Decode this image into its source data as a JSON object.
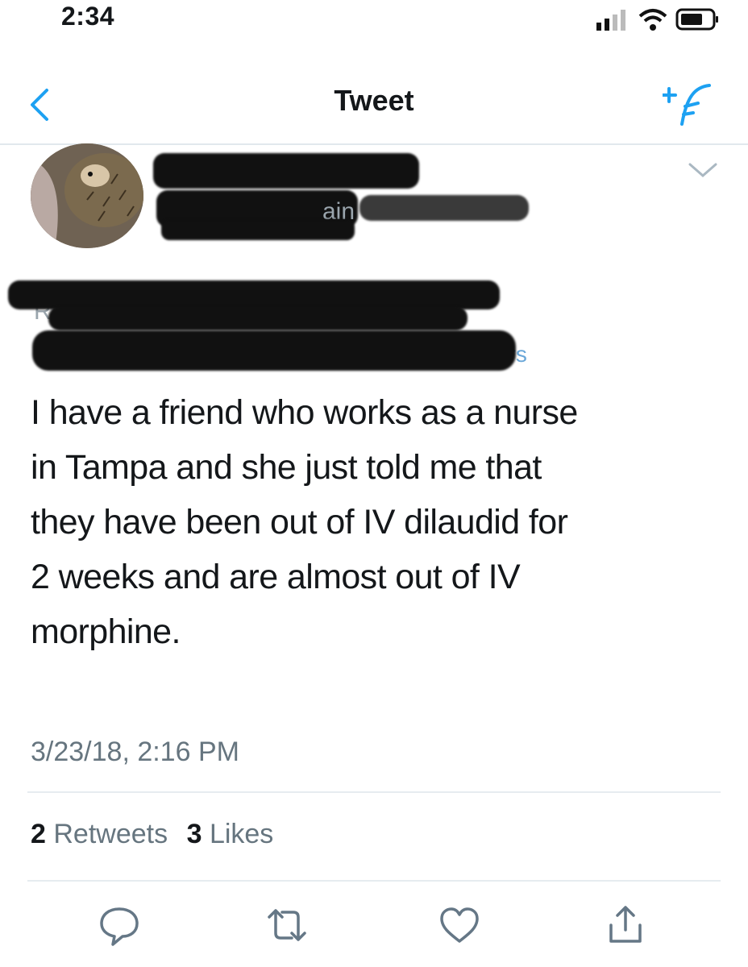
{
  "status_bar": {
    "time": "2:34"
  },
  "nav": {
    "title": "Tweet"
  },
  "author": {
    "partial_name_visible": "ain"
  },
  "reply": {
    "partial_prefix": "Re",
    "partial_others": "others"
  },
  "tweet": {
    "lines": [
      "I have a friend who works as a nurse",
      "in Tampa and she just told me that",
      "they have been out of IV dilaudid for",
      "2 weeks and are almost out of IV",
      "morphine."
    ],
    "timestamp": "3/23/18, 2:16 PM"
  },
  "stats": {
    "retweets_count": "2",
    "retweets_label": "Retweets",
    "likes_count": "3",
    "likes_label": "Likes"
  },
  "icons": {
    "back": "chevron-left-icon",
    "compose": "compose-icon",
    "more": "chevron-down-icon",
    "actions": [
      "reply-icon",
      "retweet-icon",
      "like-icon",
      "share-icon"
    ]
  },
  "colors": {
    "accent": "#1da1f2",
    "text": "#14171a",
    "secondary": "#66757f",
    "divider": "#e6ecf0"
  }
}
